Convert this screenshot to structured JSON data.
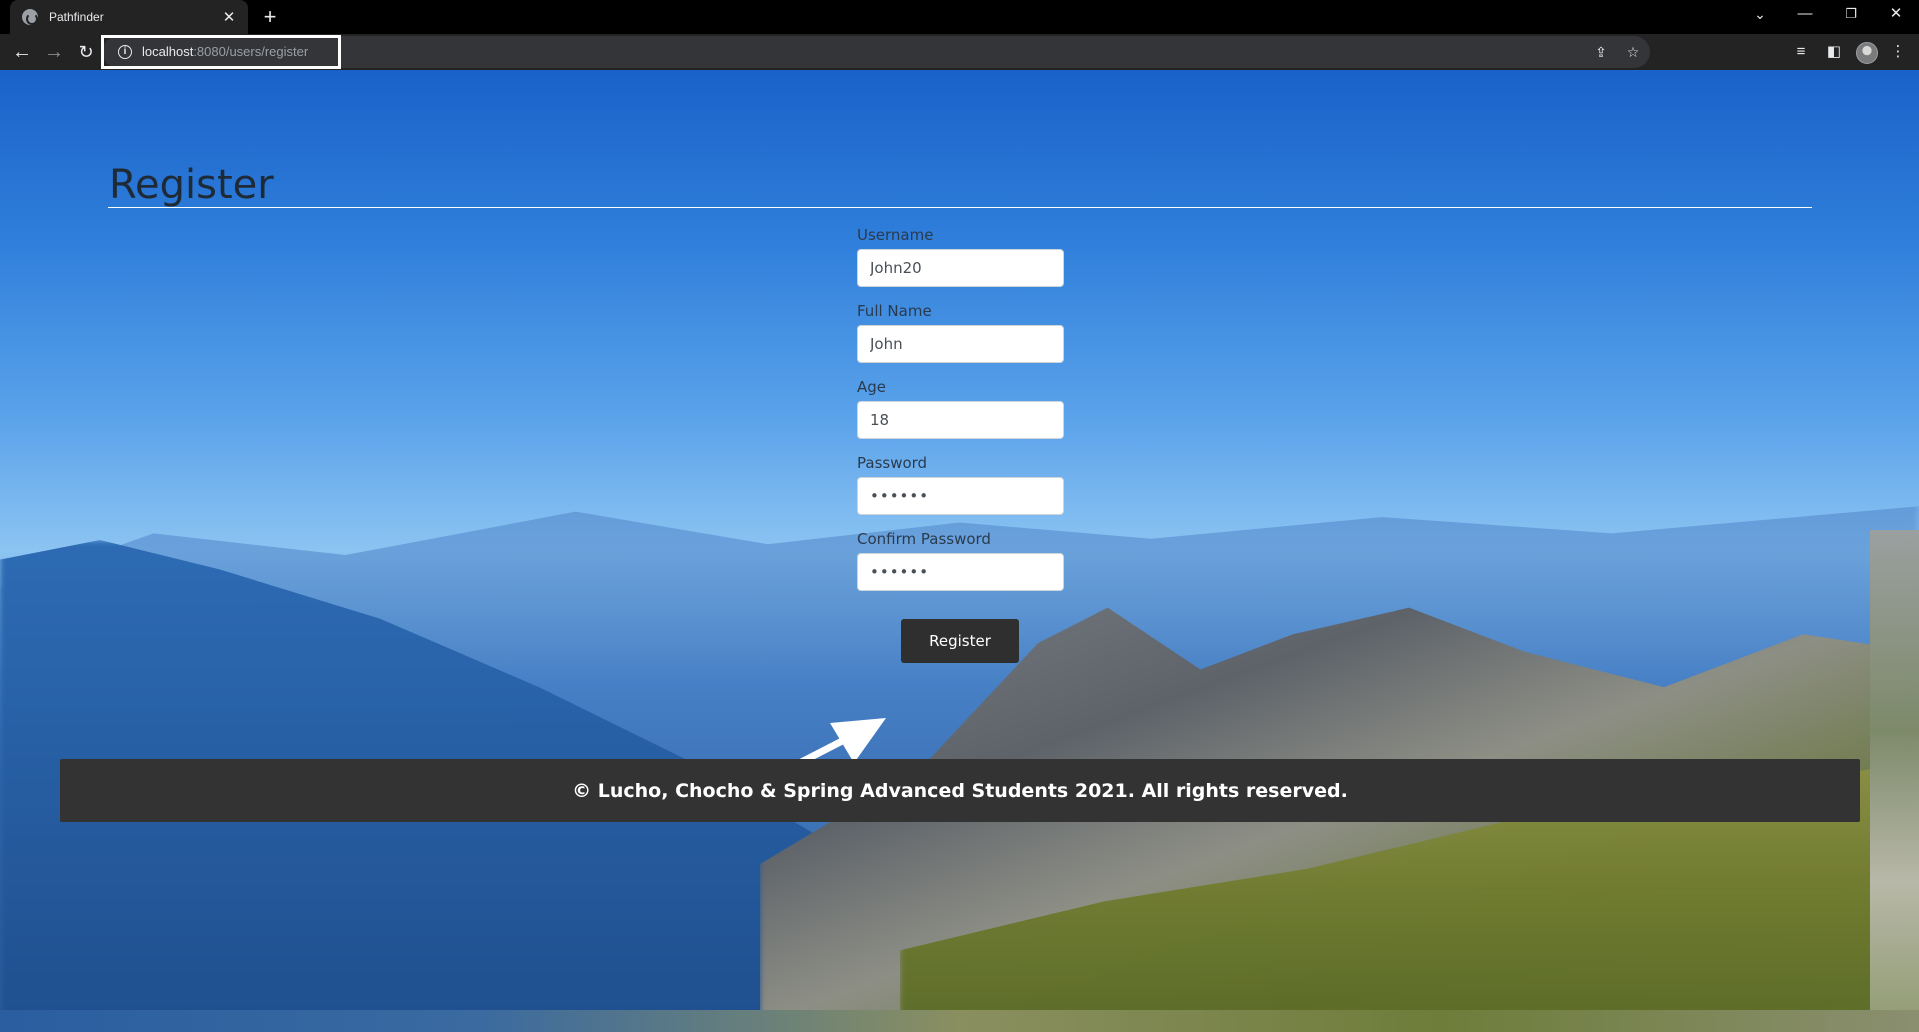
{
  "browser": {
    "tab_title": "Pathfinder",
    "tab_close": "✕",
    "new_tab": "+",
    "url_host": "localhost",
    "url_path": ":8080/users/register",
    "window_controls": [
      "⌄",
      "—",
      "❐",
      "✕"
    ],
    "icons": {
      "back": "back-arrow-icon",
      "forward": "forward-arrow-icon",
      "reload": "reload-icon",
      "share": "share-icon",
      "bookmark": "star-icon",
      "media": "media-control-icon",
      "side_panel": "side-panel-icon",
      "menu": "kebab-menu-icon"
    }
  },
  "page": {
    "title": "Register",
    "form": {
      "fields": [
        {
          "label": "Username",
          "value": "John20",
          "type": "text"
        },
        {
          "label": "Full Name",
          "value": "John",
          "type": "text"
        },
        {
          "label": "Age",
          "value": "18",
          "type": "text"
        },
        {
          "label": "Password",
          "value": "••••••",
          "type": "password"
        },
        {
          "label": "Confirm Password",
          "value": "••••••",
          "type": "password"
        }
      ],
      "submit_label": "Register"
    },
    "footer_text": "© Lucho, Chocho & Spring Advanced Students 2021. All rights reserved."
  },
  "colors": {
    "footer_bg": "#333333",
    "button_bg": "#2f2f2f",
    "title_text": "#1f2a37",
    "chrome_bg": "#232323"
  }
}
